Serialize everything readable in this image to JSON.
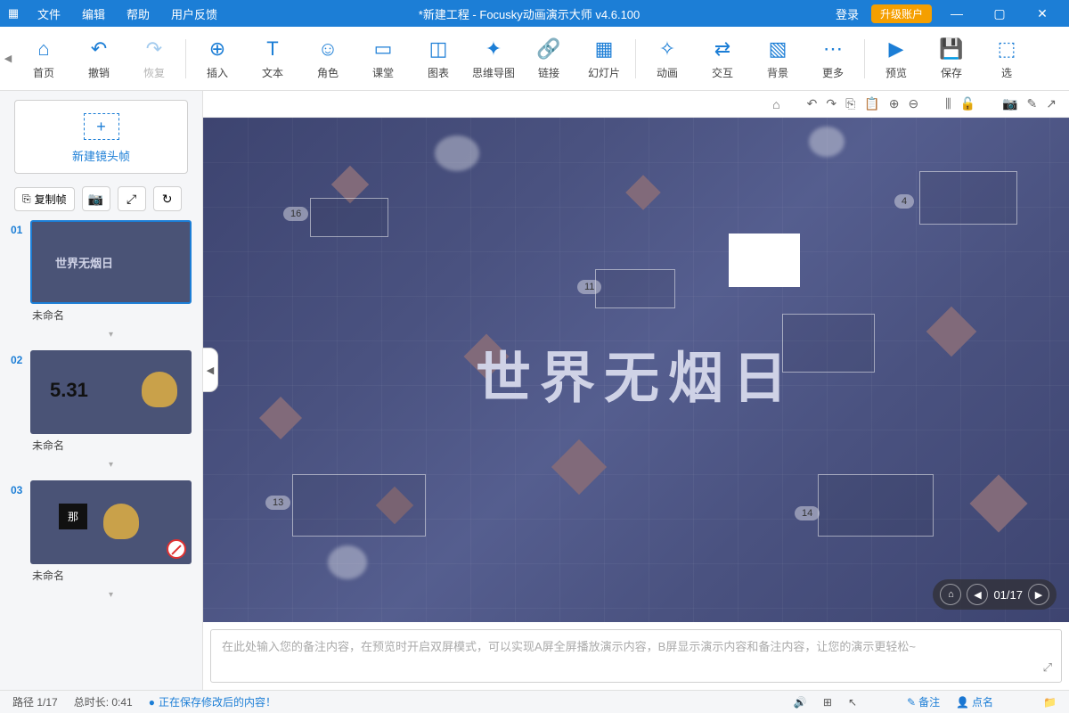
{
  "titlebar": {
    "menus": [
      "文件",
      "编辑",
      "帮助",
      "用户反馈"
    ],
    "title": "*新建工程 - Focusky动画演示大师  v4.6.100",
    "login": "登录",
    "upgrade": "升级账户"
  },
  "ribbon": [
    {
      "icon": "⌂",
      "label": "首页"
    },
    {
      "icon": "↶",
      "label": "撤销"
    },
    {
      "icon": "↷",
      "label": "恢复",
      "disabled": true
    },
    {
      "sep": true
    },
    {
      "icon": "⊕",
      "label": "插入"
    },
    {
      "icon": "T",
      "label": "文本"
    },
    {
      "icon": "☺",
      "label": "角色"
    },
    {
      "icon": "▭",
      "label": "课堂"
    },
    {
      "icon": "◫",
      "label": "图表"
    },
    {
      "icon": "✦",
      "label": "思维导图"
    },
    {
      "icon": "🔗",
      "label": "链接"
    },
    {
      "icon": "▦",
      "label": "幻灯片"
    },
    {
      "sep": true
    },
    {
      "icon": "✧",
      "label": "动画"
    },
    {
      "icon": "⇄",
      "label": "交互"
    },
    {
      "icon": "▧",
      "label": "背景"
    },
    {
      "icon": "⋯",
      "label": "更多"
    },
    {
      "sep": true
    },
    {
      "icon": "▶",
      "label": "预览"
    },
    {
      "icon": "💾",
      "label": "保存"
    },
    {
      "icon": "⬚",
      "label": "选"
    }
  ],
  "sidebar": {
    "new_frame": "新建镜头帧",
    "copy_frame": "复制帧",
    "thumbs": [
      {
        "num": "01",
        "title": "未命名",
        "selected": true,
        "kind": "title"
      },
      {
        "num": "02",
        "title": "未命名",
        "kind": "date"
      },
      {
        "num": "03",
        "title": "未命名",
        "kind": "char"
      }
    ],
    "thumb_date_text": "5.31",
    "thumb_char_text": "那"
  },
  "canvas": {
    "main_title": "世界无烟日",
    "frame_tags": [
      "16",
      "11",
      "4",
      "13",
      "14"
    ],
    "nav": {
      "current": "01",
      "total": "17"
    }
  },
  "notes": {
    "placeholder": "在此处输入您的备注内容，在预览时开启双屏模式，可以实现A屏全屏播放演示内容，B屏显示演示内容和备注内容，让您的演示更轻松~"
  },
  "statusbar": {
    "path": "路径 1/17",
    "duration": "总时长: 0:41",
    "saving": "正在保存修改后的内容！",
    "notes_btn": "备注",
    "likes_btn": "点名"
  }
}
